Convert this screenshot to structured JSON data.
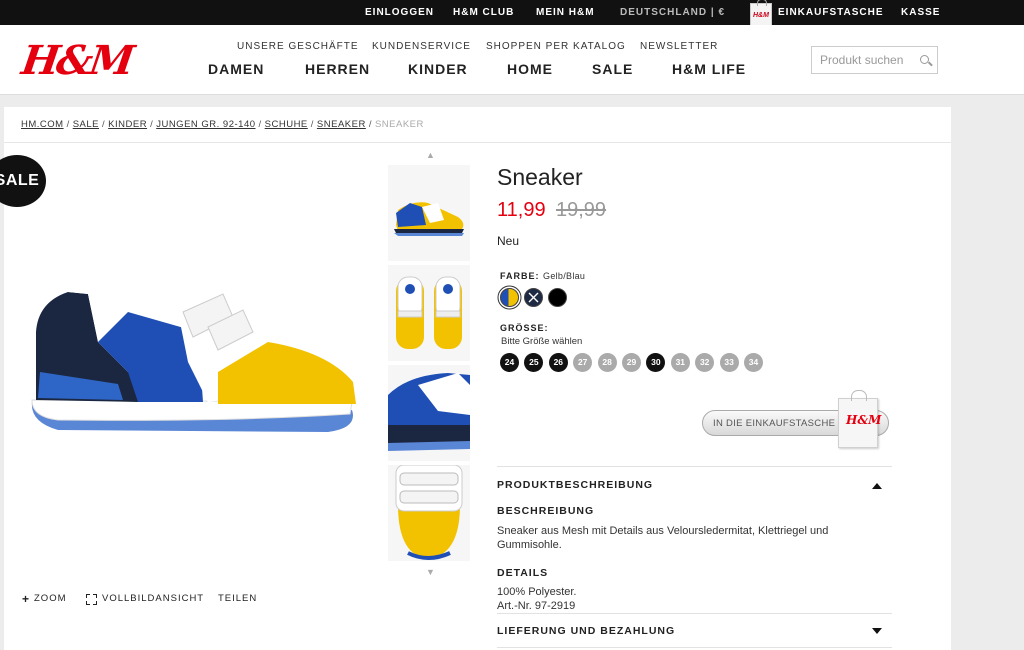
{
  "topbar": {
    "login": "EINLOGGEN",
    "club": "H&M CLUB",
    "my_hm": "MEIN H&M",
    "region": "DEUTSCHLAND | €",
    "bag_logo": "H&M",
    "bag": "EINKAUFSTASCHE",
    "checkout": "KASSE"
  },
  "header": {
    "logo": "H&M",
    "subnav": [
      "UNSERE GESCHÄFTE",
      "KUNDENSERVICE",
      "SHOPPEN PER KATALOG",
      "NEWSLETTER"
    ],
    "mainnav": [
      "DAMEN",
      "HERREN",
      "KINDER",
      "HOME",
      "SALE",
      "H&M LIFE"
    ],
    "search_placeholder": "Produkt suchen"
  },
  "breadcrumb": [
    "HM.COM",
    "SALE",
    "KINDER",
    "JUNGEN GR. 92-140",
    "SCHUHE",
    "SNEAKER",
    "SNEAKER"
  ],
  "badge": "SALE",
  "image_tools": {
    "zoom": "ZOOM",
    "fullscreen": "VOLLBILDANSICHT",
    "share": "TEILEN"
  },
  "product": {
    "title": "Sneaker",
    "price": "11,99",
    "old_price": "19,99",
    "status": "Neu",
    "color_label": "FARBE:",
    "color_value": "Gelb/Blau",
    "swatches": [
      "#f2c200",
      "#1e2a44",
      "#000000"
    ],
    "size_label": "GRÖSSE:",
    "size_hint": "Bitte Größe wählen",
    "sizes": [
      {
        "label": "24",
        "available": true
      },
      {
        "label": "25",
        "available": true
      },
      {
        "label": "26",
        "available": true
      },
      {
        "label": "27",
        "available": false
      },
      {
        "label": "28",
        "available": false
      },
      {
        "label": "29",
        "available": false
      },
      {
        "label": "30",
        "available": true
      },
      {
        "label": "31",
        "available": false
      },
      {
        "label": "32",
        "available": false
      },
      {
        "label": "33",
        "available": false
      },
      {
        "label": "34",
        "available": false
      }
    ],
    "add_to_bag": "IN DIE EINKAUFSTASCHE",
    "add_bag_logo": "H&M"
  },
  "description": {
    "section_title": "PRODUKTBESCHREIBUNG",
    "desc_heading": "BESCHREIBUNG",
    "desc_text": "Sneaker aus Mesh mit Details aus Veloursledermitat, Klettriegel und Gummisohle.",
    "details_heading": "DETAILS",
    "details_material": "100% Polyester.",
    "details_art": "Art.-Nr. 97-2919",
    "delivery_title": "LIEFERUNG UND BEZAHLUNG"
  },
  "colors": {
    "accent": "#e50010",
    "topbar": "#111111"
  }
}
